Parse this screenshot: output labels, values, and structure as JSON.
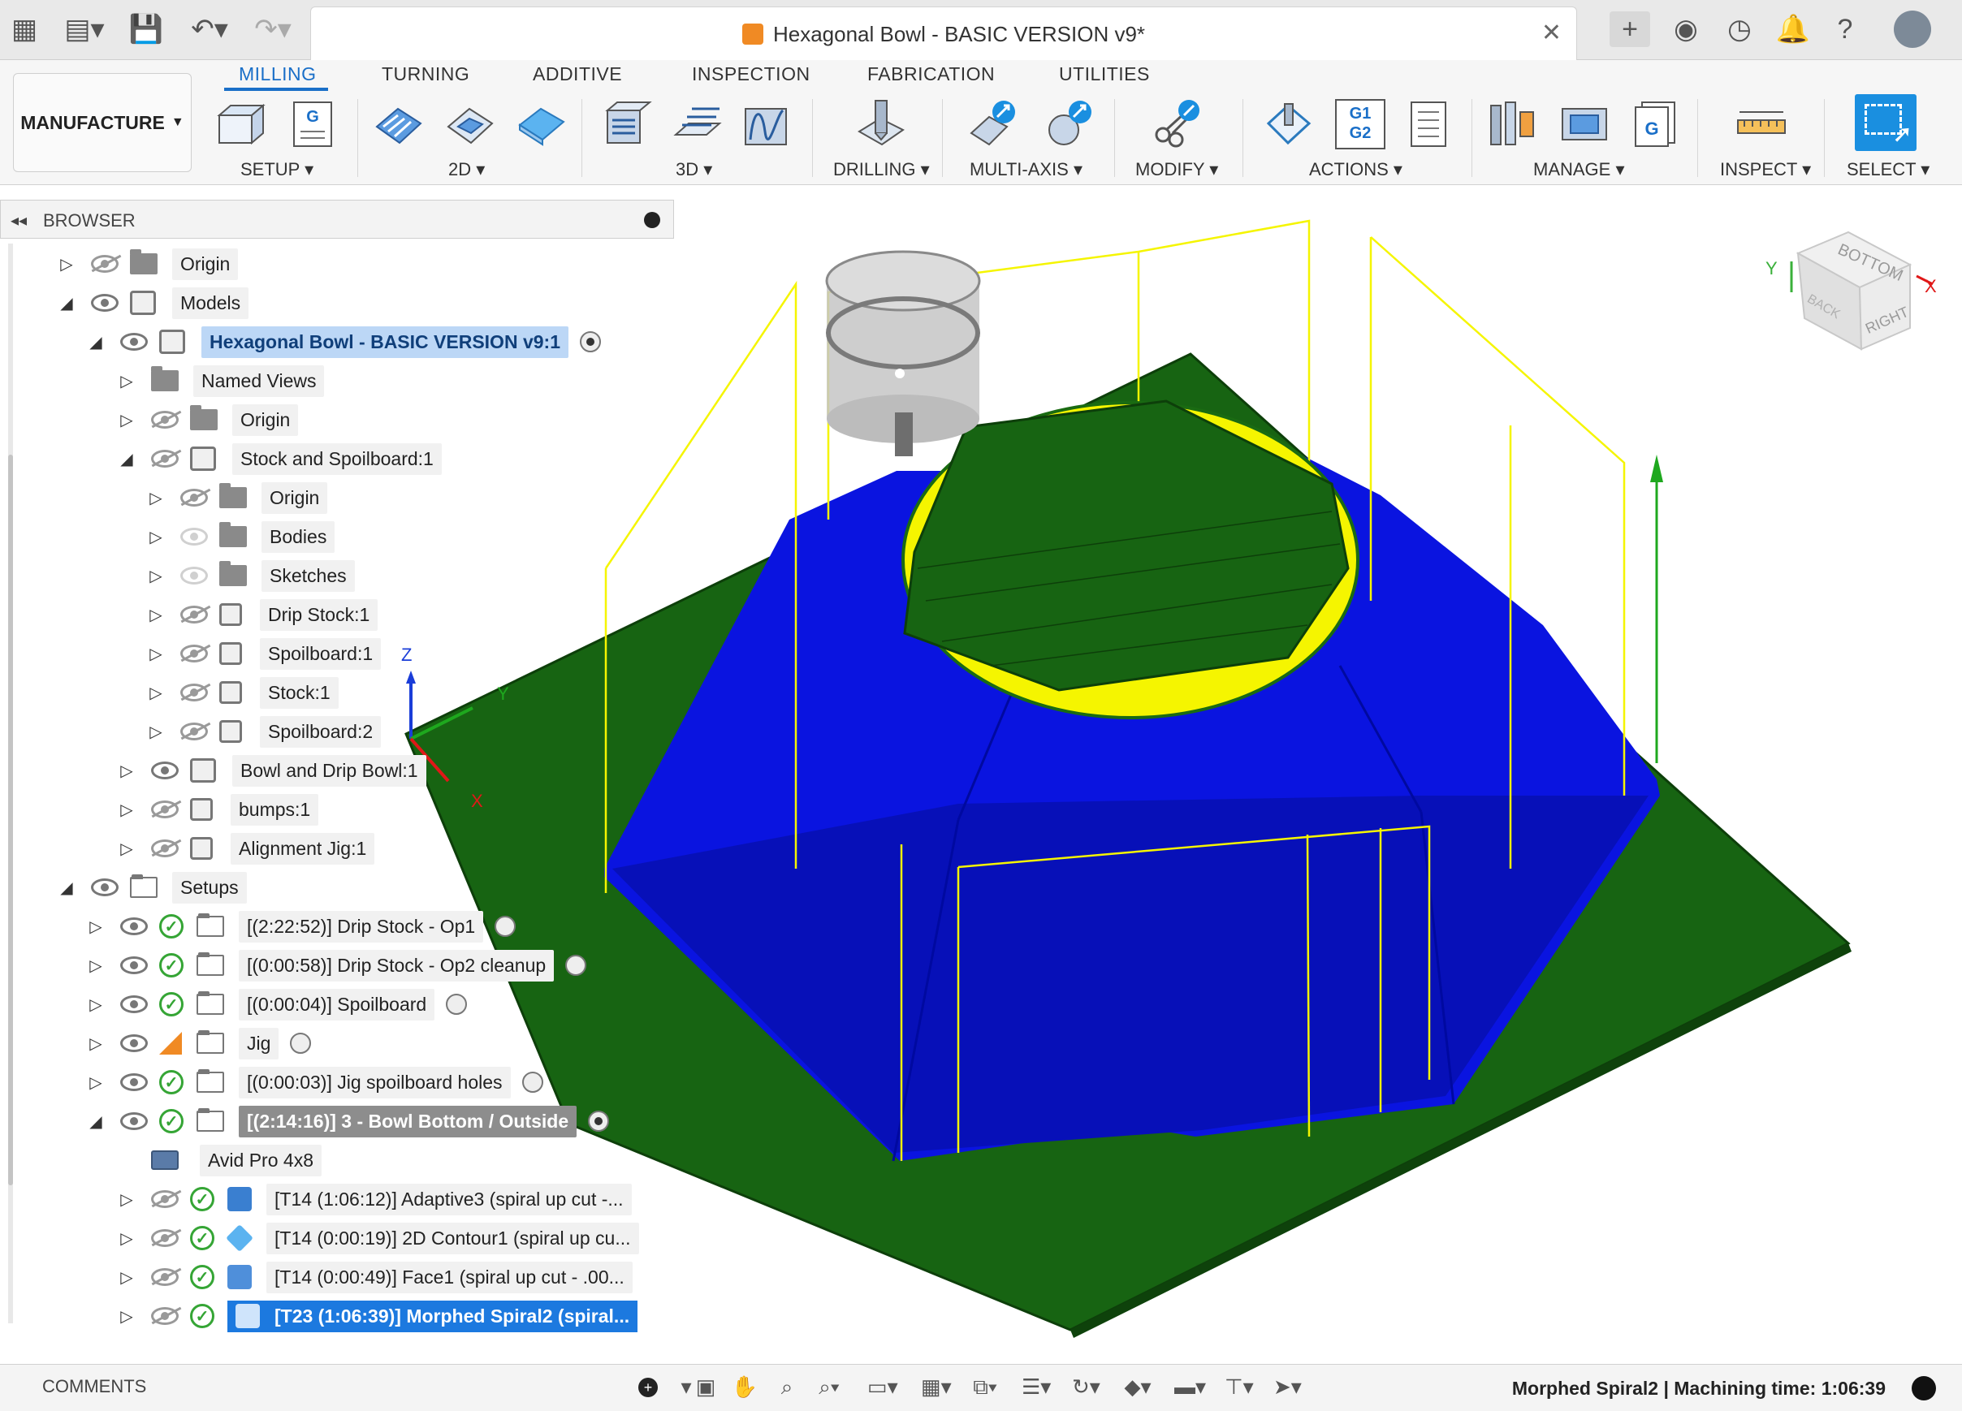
{
  "window": {
    "title": "Hexagonal Bowl - BASIC VERSION v9*"
  },
  "ribbon": {
    "workspace": "MANUFACTURE",
    "tabs": [
      {
        "label": "MILLING",
        "active": true
      },
      {
        "label": "TURNING"
      },
      {
        "label": "ADDITIVE"
      },
      {
        "label": "INSPECTION"
      },
      {
        "label": "FABRICATION"
      },
      {
        "label": "UTILITIES"
      }
    ],
    "groups": [
      "SETUP",
      "2D",
      "3D",
      "DRILLING",
      "MULTI-AXIS",
      "MODIFY",
      "ACTIONS",
      "MANAGE",
      "INSPECT",
      "SELECT"
    ],
    "g1g2": {
      "line1": "G1",
      "line2": "G2"
    }
  },
  "browser": {
    "header": "BROWSER",
    "items": [
      {
        "label": "Origin"
      },
      {
        "label": "Models"
      },
      {
        "label": "Hexagonal Bowl - BASIC VERSION v9:1"
      },
      {
        "label": "Named Views"
      },
      {
        "label": "Origin"
      },
      {
        "label": "Stock and Spoilboard:1"
      },
      {
        "label": "Origin"
      },
      {
        "label": "Bodies"
      },
      {
        "label": "Sketches"
      },
      {
        "label": "Drip Stock:1"
      },
      {
        "label": "Spoilboard:1"
      },
      {
        "label": "Stock:1"
      },
      {
        "label": "Spoilboard:2"
      },
      {
        "label": "Bowl and Drip Bowl:1"
      },
      {
        "label": "bumps:1"
      },
      {
        "label": "Alignment Jig:1"
      },
      {
        "label": "Setups"
      },
      {
        "label": "[(2:22:52)] Drip Stock - Op1"
      },
      {
        "label": "[(0:00:58)] Drip Stock - Op2 cleanup"
      },
      {
        "label": "[(0:00:04)] Spoilboard"
      },
      {
        "label": "Jig"
      },
      {
        "label": "[(0:00:03)] Jig spoilboard holes"
      },
      {
        "label": "[(2:14:16)] 3 - Bowl Bottom / Outside"
      },
      {
        "label": "Avid Pro 4x8"
      },
      {
        "label": "[T14 (1:06:12)] Adaptive3 (spiral up cut -..."
      },
      {
        "label": "[T14 (0:00:19)] 2D Contour1 (spiral up cu..."
      },
      {
        "label": "[T14 (0:00:49)] Face1 (spiral up cut - .00..."
      },
      {
        "label": "[T23 (1:06:39)] Morphed Spiral2 (spiral..."
      }
    ]
  },
  "viewcube": {
    "face_top": "BOTTOM",
    "face_right": "RIGHT",
    "face_left": "BACK",
    "axis_x": "X",
    "axis_y": "Y"
  },
  "triad": {
    "z": "Z",
    "x": "X",
    "y": "Y"
  },
  "footer": {
    "comments": "COMMENTS",
    "status": "Morphed Spiral2 | Machining time: 1:06:39"
  },
  "colors": {
    "accent": "#1a6fc8",
    "toolpath_blue": "#0a14e0",
    "stock_green": "#1a6b12",
    "rapid_yellow": "#f5f500",
    "selection_blue": "#1c79df"
  }
}
